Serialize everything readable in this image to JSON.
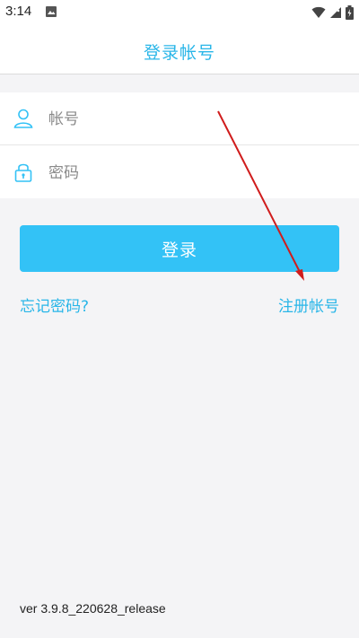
{
  "status_bar": {
    "time": "3:14",
    "icons": [
      "image-icon",
      "wifi-icon",
      "signal-icon",
      "battery-icon"
    ]
  },
  "header": {
    "title": "登录帐号"
  },
  "form": {
    "account": {
      "placeholder": "帐号",
      "value": "",
      "icon": "user-icon"
    },
    "password": {
      "placeholder": "密码",
      "value": "",
      "icon": "lock-icon"
    }
  },
  "actions": {
    "login_label": "登录",
    "forgot_label": "忘记密码?",
    "register_label": "注册帐号"
  },
  "footer": {
    "version": "ver 3.9.8_220628_release"
  },
  "colors": {
    "accent": "#29b6e8",
    "button": "#33c2f6",
    "background": "#f4f4f6",
    "annotation_arrow": "#d01c1c"
  }
}
